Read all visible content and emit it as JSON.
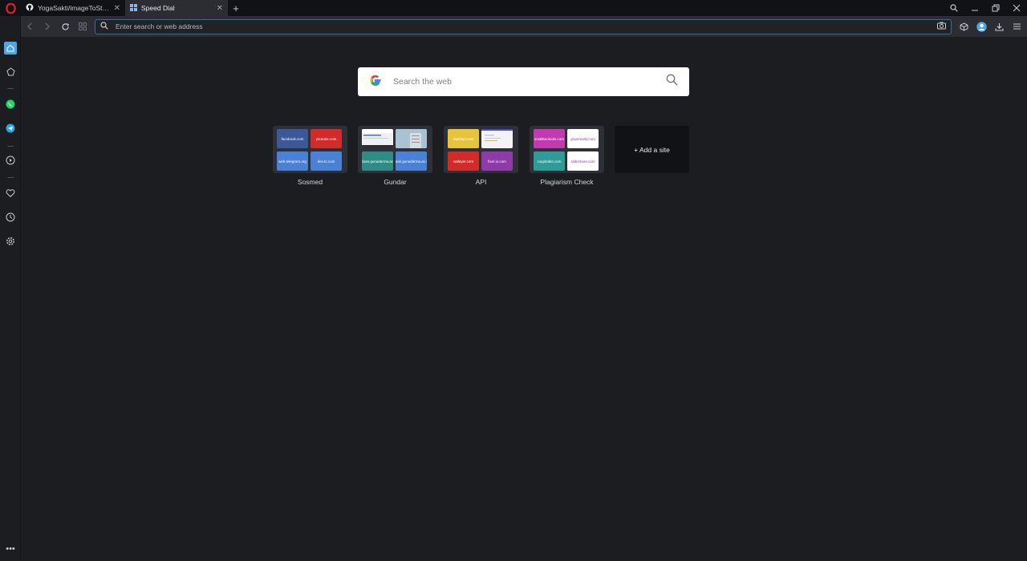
{
  "tabs": [
    {
      "label": "YogaSakti/imageToSticker",
      "active": false
    },
    {
      "label": "Speed Dial",
      "active": true
    }
  ],
  "address": {
    "placeholder": "Enter search or web address"
  },
  "search": {
    "placeholder": "Search the web"
  },
  "speed_dial": [
    {
      "title": "Sosmed",
      "sites": [
        {
          "label": "facebook.com",
          "color": "#3b5998",
          "text_color": "#ffffff"
        },
        {
          "label": "youtube.com",
          "color": "#d32a2a",
          "text_color": "#ffffff"
        },
        {
          "label": "web.telegram.org",
          "color": "#4a80d6",
          "text_color": "#ffffff"
        },
        {
          "label": "dev.to.com",
          "color": "#4a80d6",
          "text_color": "#ffffff"
        }
      ]
    },
    {
      "title": "Gundar",
      "sites": [
        {
          "label": "",
          "color": "#eef0f3",
          "text_color": "#333333"
        },
        {
          "label": "",
          "color": "#9fb8c8",
          "text_color": "#333333"
        },
        {
          "label": "v-class.gunadarma.ac.id",
          "color": "#2e8b86",
          "text_color": "#ffffff"
        },
        {
          "label": "baak.gunadarma.ac.id",
          "color": "#4a80d6",
          "text_color": "#ffffff"
        }
      ]
    },
    {
      "title": "API",
      "sites": [
        {
          "label": "rapidapi.com",
          "color": "#e7c53a",
          "text_color": "#ffffff"
        },
        {
          "label": "",
          "color": "#f3f3f7",
          "text_color": "#333333"
        },
        {
          "label": "vatlayer.com",
          "color": "#d32a2a",
          "text_color": "#ffffff"
        },
        {
          "label": "fixer.io.com",
          "color": "#8e3aa8",
          "text_color": "#ffffff"
        }
      ]
    },
    {
      "title": "Plagiarism Check",
      "sites": [
        {
          "label": "smallseotools.com",
          "color": "#c33ab0",
          "text_color": "#ffffff"
        },
        {
          "label": "grammarly.com",
          "color": "#ffffff",
          "text_color": "#8e3aa8"
        },
        {
          "label": "copyleaks.com",
          "color": "#2e9b98",
          "text_color": "#ffffff"
        },
        {
          "label": "slideshare.com",
          "color": "#ffffff",
          "text_color": "#8e3aa8"
        }
      ]
    }
  ],
  "add_site": {
    "label": "+ Add a site"
  },
  "colors": {
    "accent": "#4ea7e0",
    "whatsapp": "#25d366",
    "telegram": "#2ca5e0"
  }
}
